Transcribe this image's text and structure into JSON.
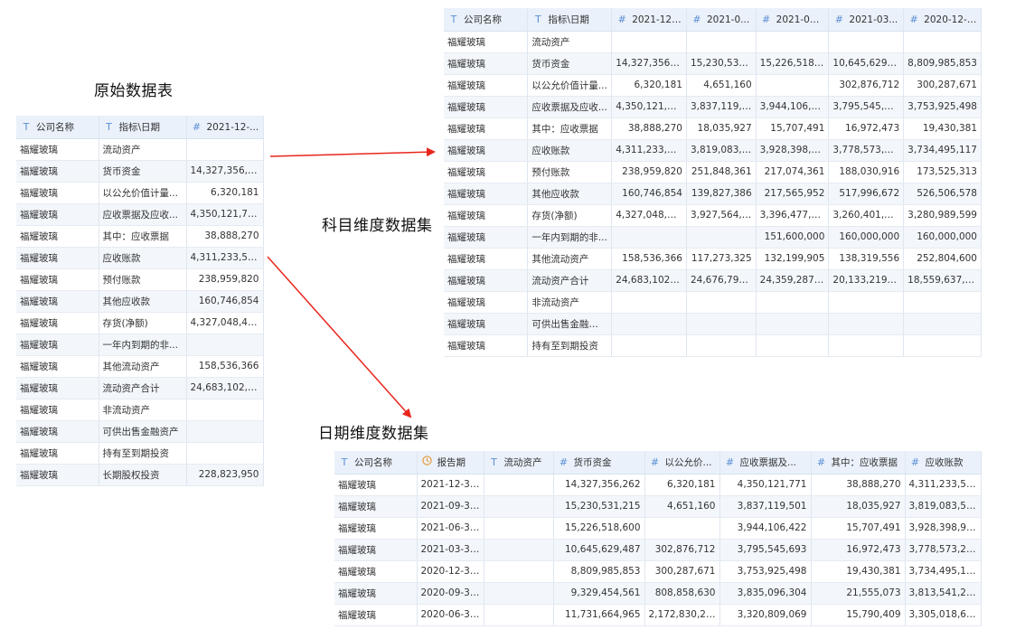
{
  "captions": {
    "original": "原始数据表",
    "subject": "科目维度数据集",
    "date": "日期维度数据集"
  },
  "icons": {
    "text": "T",
    "number": "#",
    "date": "clock-icon"
  },
  "colors": {
    "arrow": "#e8261c",
    "header_bg": "#eaf1fa",
    "text_icon": "#5b8fd6",
    "date_icon": "#e8993a"
  },
  "original_table": {
    "headers": [
      {
        "icon": "T",
        "label": "公司名称"
      },
      {
        "icon": "T",
        "label": "指标\\日期"
      },
      {
        "icon": "#",
        "label": "2021-12-..."
      }
    ],
    "rows": [
      [
        "福耀玻璃",
        "流动资产",
        ""
      ],
      [
        "福耀玻璃",
        "货币资金",
        "14,327,356,262"
      ],
      [
        "福耀玻璃",
        "以公允价值计量...",
        "6,320,181"
      ],
      [
        "福耀玻璃",
        "应收票据及应收...",
        "4,350,121,771"
      ],
      [
        "福耀玻璃",
        "其中：应收票据",
        "38,888,270"
      ],
      [
        "福耀玻璃",
        "应收账款",
        "4,311,233,501"
      ],
      [
        "福耀玻璃",
        "预付账款",
        "238,959,820"
      ],
      [
        "福耀玻璃",
        "其他应收款",
        "160,746,854"
      ],
      [
        "福耀玻璃",
        "存货(净额)",
        "4,327,048,485"
      ],
      [
        "福耀玻璃",
        "一年内到期的非...",
        ""
      ],
      [
        "福耀玻璃",
        "其他流动资产",
        "158,536,366"
      ],
      [
        "福耀玻璃",
        "流动资产合计",
        "24,683,102,104"
      ],
      [
        "福耀玻璃",
        "非流动资产",
        ""
      ],
      [
        "福耀玻璃",
        "可供出售金融资产",
        ""
      ],
      [
        "福耀玻璃",
        "持有至到期投资",
        ""
      ],
      [
        "福耀玻璃",
        "长期股权投资",
        "228,823,950"
      ]
    ]
  },
  "subject_table": {
    "headers": [
      {
        "icon": "T",
        "label": "公司名称"
      },
      {
        "icon": "T",
        "label": "指标\\日期"
      },
      {
        "icon": "#",
        "label": "2021-12-..."
      },
      {
        "icon": "#",
        "label": "2021-0..."
      },
      {
        "icon": "#",
        "label": "2021-06..."
      },
      {
        "icon": "#",
        "label": "2021-03..."
      },
      {
        "icon": "#",
        "label": "2020-12-31"
      }
    ],
    "rows": [
      [
        "福耀玻璃",
        "流动资产",
        "",
        "",
        "",
        "",
        ""
      ],
      [
        "福耀玻璃",
        "货币资金",
        "14,327,356,262",
        "15,230,531,...",
        "15,226,518,600",
        "10,645,629,487",
        "8,809,985,853"
      ],
      [
        "福耀玻璃",
        "以公允价值计量...",
        "6,320,181",
        "4,651,160",
        "",
        "302,876,712",
        "300,287,671"
      ],
      [
        "福耀玻璃",
        "应收票据及应收...",
        "4,350,121,771",
        "3,837,119,501",
        "3,944,106,422",
        "3,795,545,693",
        "3,753,925,498"
      ],
      [
        "福耀玻璃",
        "其中：应收票据",
        "38,888,270",
        "18,035,927",
        "15,707,491",
        "16,972,473",
        "19,430,381"
      ],
      [
        "福耀玻璃",
        "应收账款",
        "4,311,233,501",
        "3,819,083,574",
        "3,928,398,931",
        "3,778,573,220",
        "3,734,495,117"
      ],
      [
        "福耀玻璃",
        "预付账款",
        "238,959,820",
        "251,848,361",
        "217,074,361",
        "188,030,916",
        "173,525,313"
      ],
      [
        "福耀玻璃",
        "其他应收款",
        "160,746,854",
        "139,827,386",
        "217,565,952",
        "517,996,672",
        "526,506,578"
      ],
      [
        "福耀玻璃",
        "存货(净额)",
        "4,327,048,485",
        "3,927,564,000",
        "3,396,477,140",
        "3,260,401,002",
        "3,280,989,599"
      ],
      [
        "福耀玻璃",
        "一年内到期的非...",
        "",
        "",
        "151,600,000",
        "160,000,000",
        "160,000,000"
      ],
      [
        "福耀玻璃",
        "其他流动资产",
        "158,536,366",
        "117,273,325",
        "132,199,905",
        "138,319,556",
        "252,804,600"
      ],
      [
        "福耀玻璃",
        "流动资产合计",
        "24,683,102,104",
        "24,676,797,...",
        "24,359,287,518",
        "20,133,219,146",
        "18,559,637,229"
      ],
      [
        "福耀玻璃",
        "非流动资产",
        "",
        "",
        "",
        "",
        ""
      ],
      [
        "福耀玻璃",
        "可供出售金融资产",
        "",
        "",
        "",
        "",
        ""
      ],
      [
        "福耀玻璃",
        "持有至到期投资",
        "",
        "",
        "",
        "",
        ""
      ]
    ]
  },
  "date_table": {
    "headers": [
      {
        "icon": "T",
        "label": "公司名称"
      },
      {
        "icon": "clock",
        "label": "报告期"
      },
      {
        "icon": "T",
        "label": "流动资产"
      },
      {
        "icon": "#",
        "label": "货币资金"
      },
      {
        "icon": "#",
        "label": "以公允价..."
      },
      {
        "icon": "#",
        "label": "应收票据及..."
      },
      {
        "icon": "#",
        "label": "其中：应收票据"
      },
      {
        "icon": "#",
        "label": "应收账款"
      }
    ],
    "rows": [
      [
        "福耀玻璃",
        "2021-12-31...",
        "",
        "14,327,356,262",
        "6,320,181",
        "4,350,121,771",
        "38,888,270",
        "4,311,233,501"
      ],
      [
        "福耀玻璃",
        "2021-09-30...",
        "",
        "15,230,531,215",
        "4,651,160",
        "3,837,119,501",
        "18,035,927",
        "3,819,083,574"
      ],
      [
        "福耀玻璃",
        "2021-06-30...",
        "",
        "15,226,518,600",
        "",
        "3,944,106,422",
        "15,707,491",
        "3,928,398,931"
      ],
      [
        "福耀玻璃",
        "2021-03-31...",
        "",
        "10,645,629,487",
        "302,876,712",
        "3,795,545,693",
        "16,972,473",
        "3,778,573,220"
      ],
      [
        "福耀玻璃",
        "2020-12-31...",
        "",
        "8,809,985,853",
        "300,287,671",
        "3,753,925,498",
        "19,430,381",
        "3,734,495,117"
      ],
      [
        "福耀玻璃",
        "2020-09-30...",
        "",
        "9,329,454,561",
        "808,858,630",
        "3,835,096,304",
        "21,555,073",
        "3,813,541,231"
      ],
      [
        "福耀玻璃",
        "2020-06-30...",
        "",
        "11,731,664,965",
        "2,172,830,274",
        "3,320,809,069",
        "15,790,409",
        "3,305,018,660"
      ]
    ]
  }
}
